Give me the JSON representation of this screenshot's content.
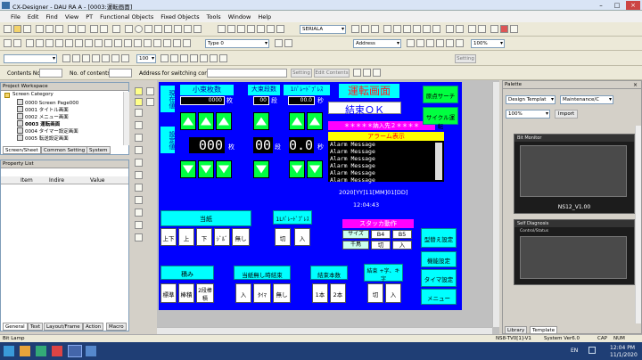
{
  "window": {
    "title": "CX-Designer - DAU RA A - [0003:運転画面]"
  },
  "menu": [
    "File",
    "Edit",
    "Find",
    "View",
    "PT",
    "Functional Objects",
    "Fixed Objects",
    "Tools",
    "Window",
    "Help"
  ],
  "toolbar": {
    "combo_serial": "SERIALA",
    "combo_type": "Type 0",
    "combo_address": "Address",
    "combo_zoom": "100%",
    "font_size": "100",
    "setting1": "Setting",
    "setting2": "Setting",
    "contents_no_label": "Contents No.",
    "no_contents_label": "No. of contents",
    "address_switch_label": "Address for switching contents",
    "edit_contents": "Edit Contents"
  },
  "workspace": {
    "title": "Project Workspace",
    "root": "Screen Category",
    "items": [
      "0000 Screen Page000",
      "0001 タイトル画面",
      "0002 メニュー画面",
      "0003 運転画面",
      "0004 タイマー設定画面",
      "0005 転送設定画面"
    ],
    "tabs": [
      "Screen/Sheet",
      "Common Setting",
      "System"
    ]
  },
  "property": {
    "title": "Property List",
    "columns": [
      "Item",
      "Indire",
      "Value"
    ],
    "tabs": [
      "General",
      "Text",
      "Layout/Frame",
      "Action",
      "Macro"
    ]
  },
  "screen": {
    "title": "運転画面",
    "status_display": "結束ＯＫ",
    "counter_labels": {
      "small": "小束枚数",
      "large": "大束段数",
      "per_bundle": "1ﾊﾟﾚｰﾄﾞﾌﾟﾚｽ"
    },
    "set_labels": {
      "current": "現在値",
      "setting": "設定値"
    },
    "current_values": [
      "0000",
      "00",
      "00.0"
    ],
    "units": {
      "sheets": "枚",
      "stage": "段",
      "sec": "秒"
    },
    "setting_values": [
      "000",
      "00",
      "0.0"
    ],
    "alarm_banner": "＊＊＊＊＊納入先２＊＊＊＊",
    "alarm_title": "アラーム表示",
    "alarm_lines": [
      "Alarm Message",
      "Alarm Message",
      "Alarm Message",
      "Alarm Message",
      "Alarm Message",
      "Alarm Message"
    ],
    "datetime_line1": "2020[YY]11[MM]01[DD]",
    "datetime_line2": "12:04:43",
    "right_buttons": [
      "原点サーチ",
      "サイクル運転"
    ],
    "menu_buttons": [
      "型替え設定",
      "機能設定",
      "タイマ設定",
      "メニュー"
    ],
    "paper": {
      "title": "当紙",
      "buttons": [
        "上下",
        "上",
        "下",
        "ｼﾞﾙﾞ",
        "無し"
      ]
    },
    "palette_press": {
      "title": "1Lﾊﾟﾚｰﾄﾞﾌﾟﾚｽ",
      "buttons": [
        "切",
        "入"
      ]
    },
    "stacker": {
      "title": "スタッカ動作",
      "buttons": [
        "サイズ",
        "B4",
        "B5",
        "千鳥",
        "切",
        "入"
      ]
    },
    "stacking": {
      "title": "積み",
      "buttons": [
        "標準",
        "棒積",
        "2段棒積"
      ]
    },
    "no_paper_end": {
      "title": "当紙無し時結束",
      "buttons": [
        "入",
        "ﾀｲﾏ",
        "無し"
      ]
    },
    "bundle_count": {
      "title": "結束本数",
      "buttons": [
        "1本",
        "2本"
      ]
    },
    "binding": {
      "title": "結束 +字、キ字",
      "buttons": [
        "切",
        "入"
      ]
    }
  },
  "palette": {
    "title": "Palette",
    "combo_design": "Design Templat",
    "combo_maint": "Maintenance/C",
    "combo_zoom": "100%",
    "import": "Import",
    "thumb1_caption": "NS12_V1.00",
    "thumb1_header": "Bit Monitor",
    "thumb2_header": "Self Diagnosis",
    "thumb2_subheader": "Control/Status",
    "tabs": [
      "Library",
      "Template"
    ]
  },
  "status": {
    "left": "Bit Lamp",
    "model": "NS8-TV0[1]-V1",
    "version": "System Ver6.0",
    "caps": "CAP",
    "num": "NUM"
  },
  "taskbar": {
    "time": "12:04 PM",
    "date": "11/1/2020",
    "lang": "EN"
  }
}
